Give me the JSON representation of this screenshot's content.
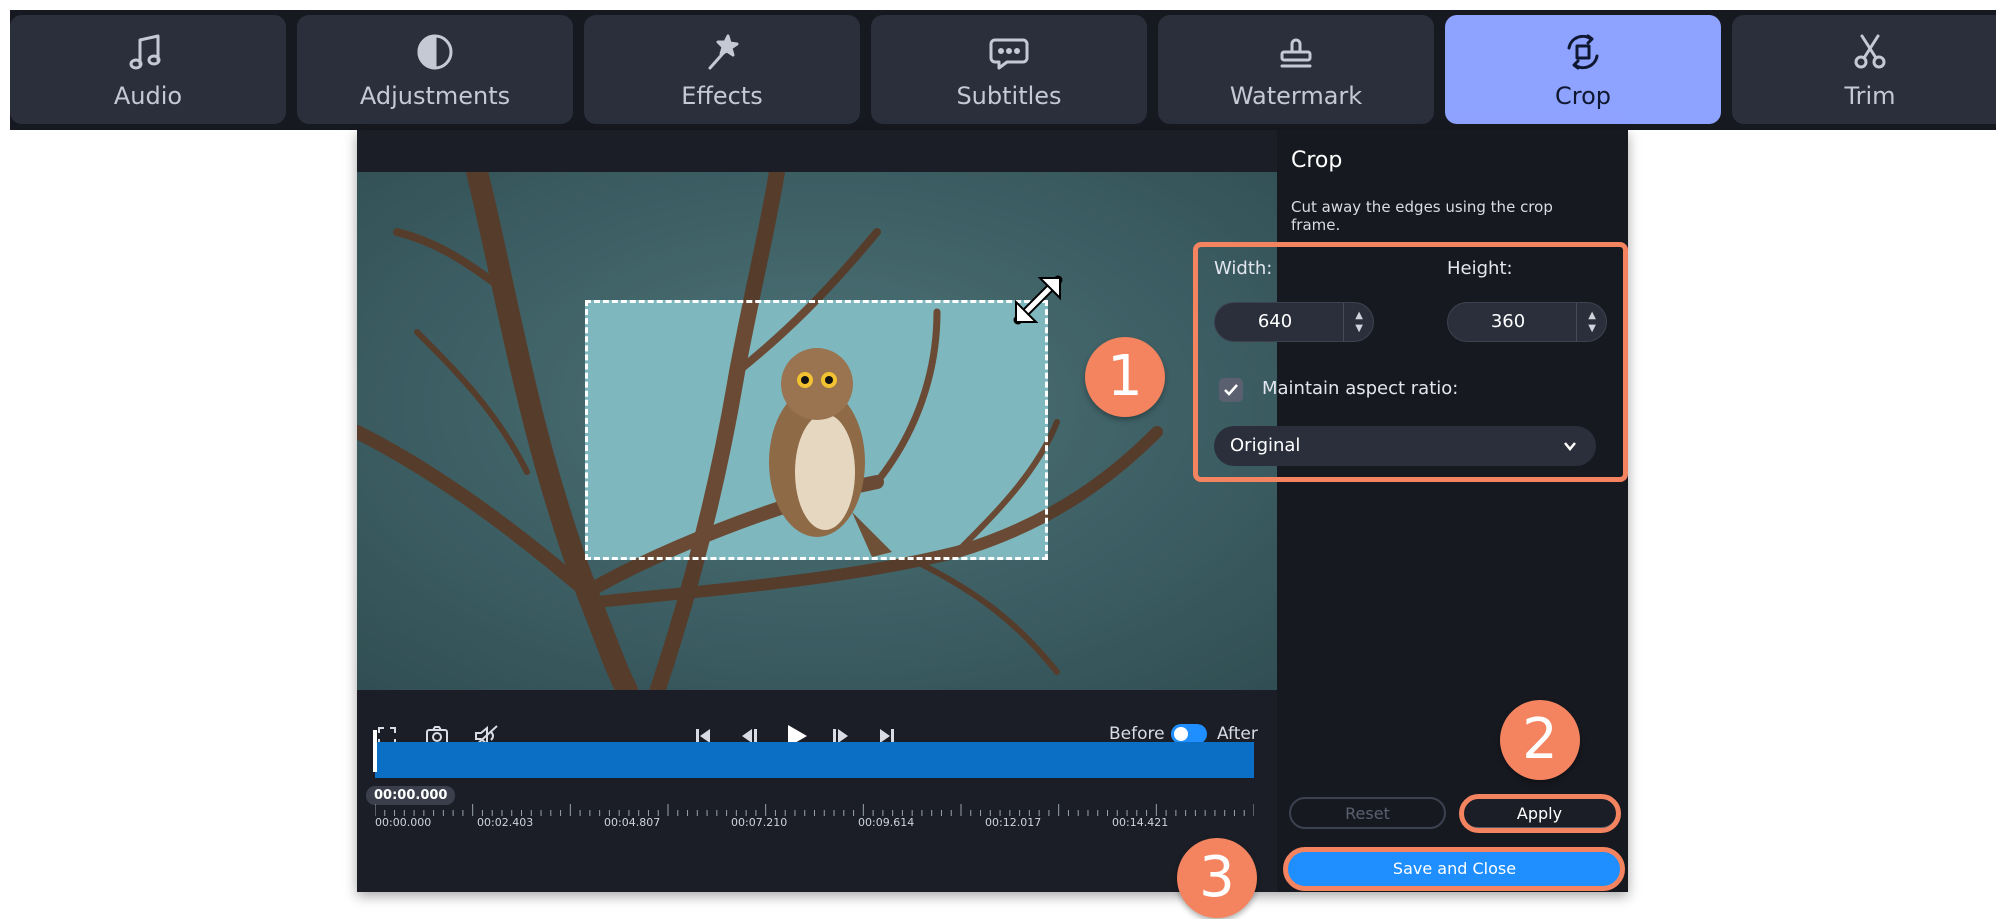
{
  "tabs": [
    {
      "label": "Audio",
      "icon": "music-note-icon",
      "active": false
    },
    {
      "label": "Adjustments",
      "icon": "contrast-icon",
      "active": false
    },
    {
      "label": "Effects",
      "icon": "magic-wand-icon",
      "active": false
    },
    {
      "label": "Subtitles",
      "icon": "speech-bubble-icon",
      "active": false
    },
    {
      "label": "Watermark",
      "icon": "stamp-icon",
      "active": false
    },
    {
      "label": "Crop",
      "icon": "crop-rotate-icon",
      "active": true
    },
    {
      "label": "Trim",
      "icon": "scissors-icon",
      "active": false
    }
  ],
  "player": {
    "toggle_before": "Before",
    "toggle_after": "After",
    "current_time": "00:00.000",
    "ruler_labels": [
      "00:00.000",
      "00:02.403",
      "00:04.807",
      "00:07.210",
      "00:09.614",
      "00:12.017",
      "00:14.421"
    ]
  },
  "panel": {
    "title": "Crop",
    "description": "Cut away the edges using the crop frame.",
    "width_label": "Width:",
    "width_value": "640",
    "height_label": "Height:",
    "height_value": "360",
    "maintain_label": "Maintain aspect ratio:",
    "maintain_checked": true,
    "aspect_value": "Original",
    "reset_label": "Reset",
    "apply_label": "Apply",
    "save_label": "Save and Close"
  },
  "callouts": [
    "1",
    "2",
    "3"
  ],
  "colors": {
    "accent_tab": "#8ea3ff",
    "callout": "#f4845f",
    "primary_button": "#1f8fff",
    "timeline": "#0b6fc6"
  }
}
